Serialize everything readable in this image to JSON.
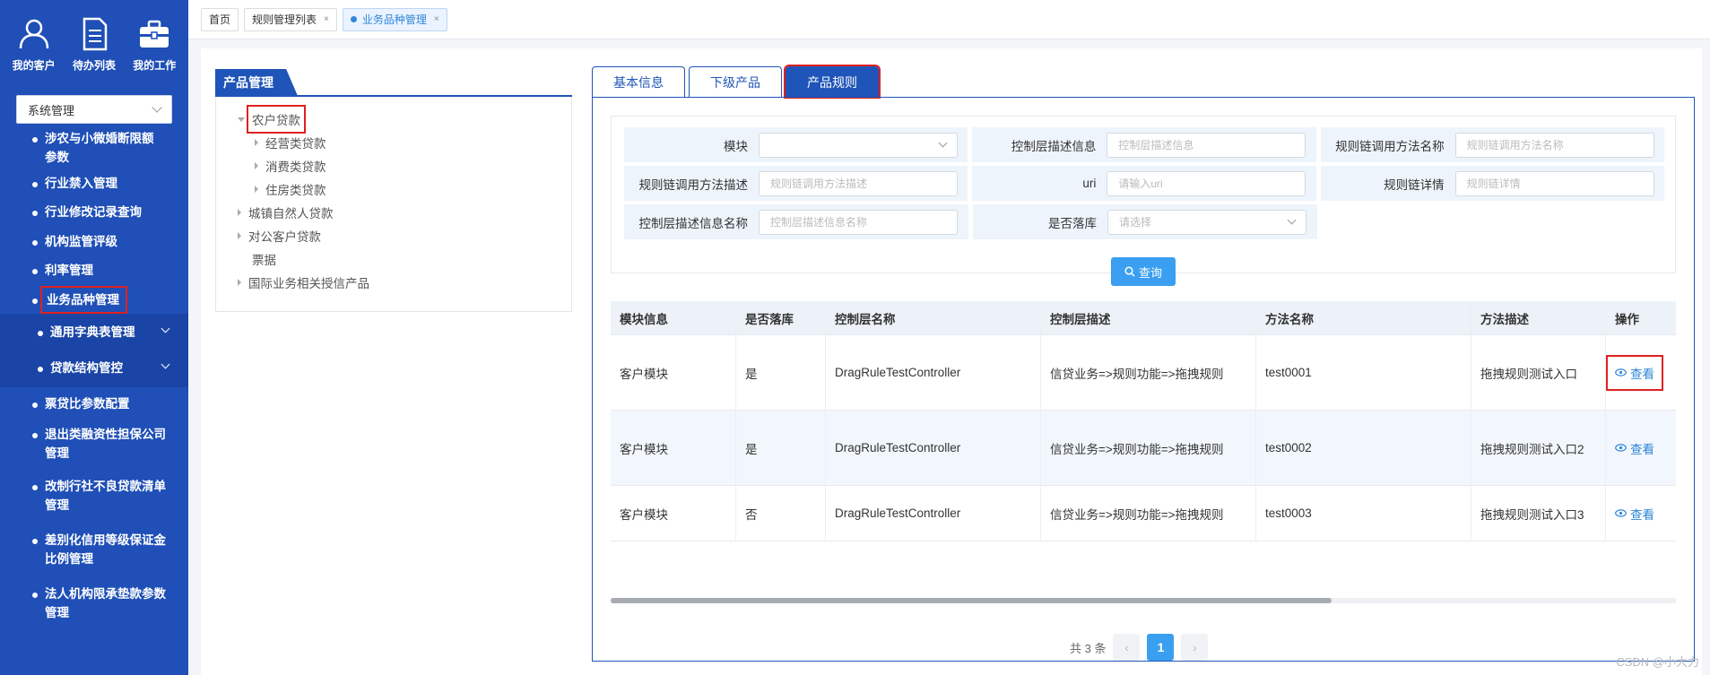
{
  "sidebar": {
    "top_icons": [
      {
        "label": "我的客户",
        "icon": "user-icon"
      },
      {
        "label": "待办列表",
        "icon": "document-list-icon"
      },
      {
        "label": "我的工作",
        "icon": "briefcase-icon"
      }
    ],
    "system_select": "系统管理",
    "menu": [
      {
        "label": "涉农与小微婚断限额参数"
      },
      {
        "label": "行业禁入管理"
      },
      {
        "label": "行业修改记录查询"
      },
      {
        "label": "机构监管评级"
      },
      {
        "label": "利率管理"
      },
      {
        "label": "业务品种管理",
        "active": true
      },
      {
        "label": "通用字典表管理",
        "expandable": true
      },
      {
        "label": "贷款结构管控",
        "expandable": true
      },
      {
        "label": "票贷比参数配置"
      },
      {
        "label": "退出类融资性担保公司管理"
      },
      {
        "label": "改制行社不良贷款清单管理"
      },
      {
        "label": "差别化信用等级保证金比例管理"
      },
      {
        "label": "法人机构限承垫款参数管理"
      }
    ]
  },
  "page_tabs": [
    {
      "label": "首页",
      "closable": false
    },
    {
      "label": "规则管理列表",
      "closable": true
    },
    {
      "label": "业务品种管理",
      "closable": true,
      "active": true
    }
  ],
  "close_glyph": "×",
  "left_panel": {
    "title": "产品管理",
    "tree": [
      {
        "label": "农户贷款",
        "level": 1,
        "state": "open",
        "selected": true
      },
      {
        "label": "经营类贷款",
        "level": 2,
        "state": "closed"
      },
      {
        "label": "消费类贷款",
        "level": 2,
        "state": "closed"
      },
      {
        "label": "住房类贷款",
        "level": 2,
        "state": "closed"
      },
      {
        "label": "城镇自然人贷款",
        "level": 1,
        "state": "closed"
      },
      {
        "label": "对公客户贷款",
        "level": 1,
        "state": "closed"
      },
      {
        "label": "票据",
        "level": 1,
        "state": "none"
      },
      {
        "label": "国际业务相关授信产品",
        "level": 1,
        "state": "closed"
      }
    ]
  },
  "right_tabs": [
    {
      "label": "基本信息"
    },
    {
      "label": "下级产品"
    },
    {
      "label": "产品规则",
      "active": true
    }
  ],
  "filters": {
    "row1": [
      {
        "label": "模块",
        "placeholder": "",
        "type": "select"
      },
      {
        "label": "控制层描述信息",
        "placeholder": "控制层描述信息",
        "type": "input"
      },
      {
        "label": "规则链调用方法名称",
        "placeholder": "规则链调用方法名称",
        "type": "input"
      }
    ],
    "row2": [
      {
        "label": "规则链调用方法描述",
        "placeholder": "规则链调用方法描述",
        "type": "input"
      },
      {
        "label": "uri",
        "placeholder": "请输入uri",
        "type": "input"
      },
      {
        "label": "规则链详情",
        "placeholder": "规则链详情",
        "type": "input"
      }
    ],
    "row3": [
      {
        "label": "控制层描述信息名称",
        "placeholder": "控制层描述信息名称",
        "type": "input"
      },
      {
        "label": "是否落库",
        "placeholder": "请选择",
        "type": "select"
      }
    ]
  },
  "query_button": "查询",
  "table": {
    "headers": [
      "模块信息",
      "是否落库",
      "控制层名称",
      "控制层描述",
      "方法名称",
      "方法描述",
      "操作"
    ],
    "rows": [
      [
        "客户模块",
        "是",
        "DragRuleTestController",
        "信贷业务=>规则功能=>拖拽规则",
        "test0001",
        "拖拽规则测试入口",
        "查看"
      ],
      [
        "客户模块",
        "是",
        "DragRuleTestController",
        "信贷业务=>规则功能=>拖拽规则",
        "test0002",
        "拖拽规则测试入口2",
        "查看"
      ],
      [
        "客户模块",
        "否",
        "DragRuleTestController",
        "信贷业务=>规则功能=>拖拽规则",
        "test0003",
        "拖拽规则测试入口3",
        "查看"
      ]
    ]
  },
  "pager": {
    "total_text": "共 3 条",
    "current_page": "1",
    "prev": "‹",
    "next": "›"
  },
  "watermark": "CSDN @小大力"
}
